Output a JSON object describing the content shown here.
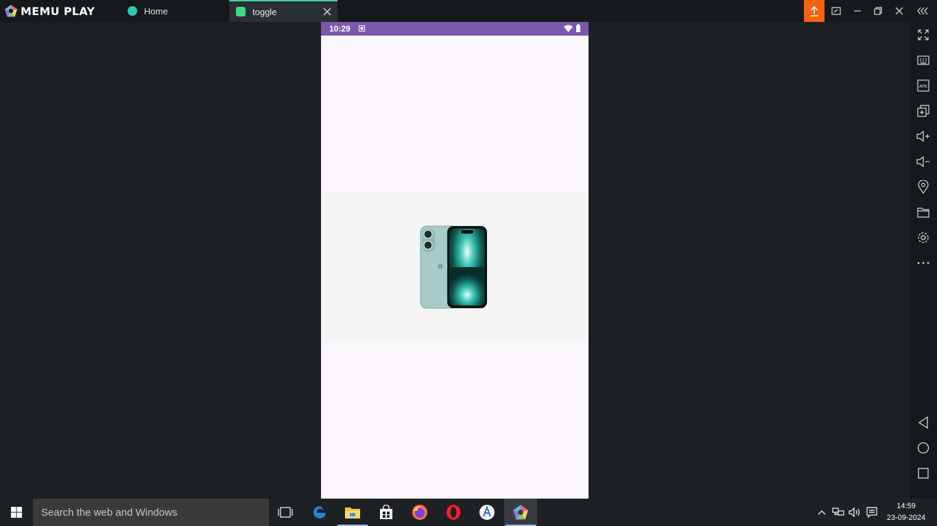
{
  "app": {
    "name": "MEMU PLAY"
  },
  "tabs": [
    {
      "label": "Home",
      "icon": "memu-home-icon",
      "active": false
    },
    {
      "label": "toggle",
      "icon": "android-icon",
      "active": true
    }
  ],
  "colors": {
    "accent_upload": "#f7620f",
    "statusbar": "#7a59ad",
    "tab_active_border": "#3fd0b0",
    "screen_bg": "#fcf7fc"
  },
  "phone": {
    "status_time": "10:29",
    "content_image": "iphone-product-image"
  },
  "sidebar": [
    "fullscreen-icon",
    "keyboard-icon",
    "apk-icon",
    "multi-instance-icon",
    "volume-up-icon",
    "volume-down-icon",
    "location-icon",
    "folder-icon",
    "settings-icon",
    "more-icon",
    "back-icon",
    "home-circle-icon",
    "recents-icon"
  ],
  "taskbar": {
    "search_placeholder": "Search the web and Windows",
    "time": "14:59",
    "date": "23-09-2024"
  }
}
